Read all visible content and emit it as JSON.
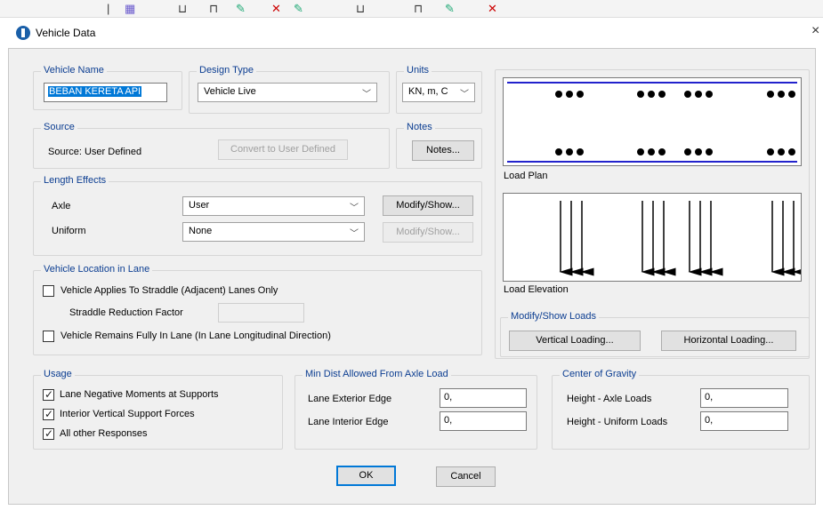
{
  "window": {
    "title": "Vehicle Data",
    "close_glyph": "×"
  },
  "vehicle_name": {
    "legend": "Vehicle Name",
    "value": "BEBAN KERETA API"
  },
  "design_type": {
    "legend": "Design Type",
    "value": "Vehicle Live"
  },
  "units": {
    "legend": "Units",
    "value": "KN, m, C"
  },
  "source": {
    "legend": "Source",
    "text": "Source: User Defined",
    "convert_label": "Convert to User Defined"
  },
  "notes": {
    "legend": "Notes",
    "button_label": "Notes..."
  },
  "length_effects": {
    "legend": "Length Effects",
    "axle_label": "Axle",
    "axle_value": "User",
    "axle_button": "Modify/Show...",
    "uniform_label": "Uniform",
    "uniform_value": "None",
    "uniform_button": "Modify/Show..."
  },
  "location": {
    "legend": "Vehicle Location in Lane",
    "straddle_label": "Vehicle Applies To Straddle (Adjacent) Lanes Only",
    "reduction_label": "Straddle Reduction Factor",
    "remains_label": "Vehicle Remains Fully In Lane (In Lane Longitudinal Direction)"
  },
  "load_plan": {
    "caption": "Load Plan"
  },
  "load_elevation": {
    "caption": "Load Elevation"
  },
  "modify_loads": {
    "legend": "Modify/Show Loads",
    "vertical_label": "Vertical Loading...",
    "horizontal_label": "Horizontal Loading..."
  },
  "usage": {
    "legend": "Usage",
    "items": [
      {
        "label": "Lane Negative Moments at Supports",
        "checked": true
      },
      {
        "label": "Interior Vertical Support Forces",
        "checked": true
      },
      {
        "label": "All other Responses",
        "checked": true
      }
    ]
  },
  "min_dist": {
    "legend": "Min Dist Allowed From Axle Load",
    "exterior_label": "Lane Exterior Edge",
    "exterior_value": "0,",
    "interior_label": "Lane Interior Edge",
    "interior_value": "0,"
  },
  "cog": {
    "legend": "Center of Gravity",
    "axle_label": "Height - Axle Loads",
    "axle_value": "0,",
    "uniform_label": "Height - Uniform Loads",
    "uniform_value": "0,"
  },
  "footer": {
    "ok_label": "OK",
    "cancel_label": "Cancel"
  },
  "colors": {
    "legend_text": "#0b3d91",
    "plan_line": "#2222cc",
    "selection": "#0078d7"
  }
}
